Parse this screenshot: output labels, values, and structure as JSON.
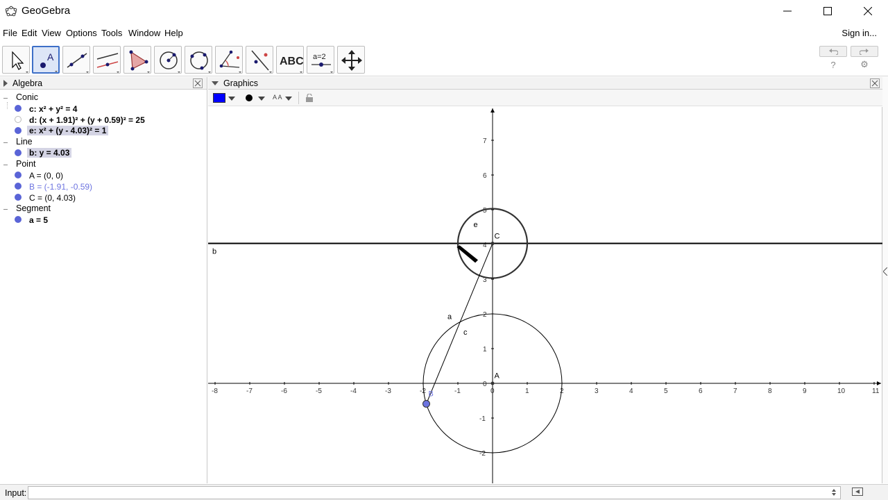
{
  "window": {
    "title": "GeoGebra"
  },
  "menu": {
    "items": [
      "File",
      "Edit",
      "View",
      "Options",
      "Tools",
      "Window",
      "Help"
    ],
    "sign_in": "Sign in..."
  },
  "toolbar": {
    "tools": [
      "move-tool",
      "point-tool",
      "line-tool",
      "perpendicular-tool",
      "polygon-tool",
      "circle-center-tool",
      "circle-three-points-tool",
      "angle-tool",
      "reflect-tool",
      "text-tool",
      "slider-tool",
      "move-graphics-tool"
    ],
    "text_tool_label": "ABC",
    "slider_tool_label": "a=2"
  },
  "algebra": {
    "title": "Algebra",
    "categories": [
      {
        "label": "Conic",
        "items": [
          "c: x² + y² = 4",
          "d: (x + 1.91)² + (y + 0.59)² = 25",
          "e: x² + (y - 4.03)² = 1"
        ]
      },
      {
        "label": "Line",
        "items": [
          "b: y = 4.03"
        ]
      },
      {
        "label": "Point",
        "items": [
          "A = (0, 0)",
          "B = (-1.91, -0.59)",
          "C = (0, 4.03)"
        ]
      },
      {
        "label": "Segment",
        "items": [
          "a = 5"
        ]
      }
    ]
  },
  "graphics": {
    "title": "Graphics",
    "color_swatch": "#0000ff",
    "text_size_label": "A A",
    "x_ticks": [
      -8,
      -7,
      -6,
      -5,
      -4,
      -3,
      -2,
      -1,
      0,
      1,
      2,
      3,
      4,
      5,
      6,
      7,
      8,
      9,
      10,
      11
    ],
    "y_ticks": [
      -2,
      -1,
      0,
      1,
      2,
      3,
      4,
      5,
      6,
      7
    ],
    "labels": {
      "line_b": "b",
      "circle_e": "e",
      "point_C": "C",
      "segment_a": "a",
      "circle_c": "c",
      "point_A": "A",
      "point_B": "B"
    },
    "objects": {
      "circle_c": {
        "cx": 0,
        "cy": 0,
        "r": 2
      },
      "circle_e": {
        "cx": 0,
        "cy": 4.03,
        "r": 1
      },
      "line_b": {
        "y": 4.03
      },
      "point_A": [
        0,
        0
      ],
      "point_B": [
        -1.91,
        -0.59
      ],
      "point_C": [
        0,
        4.03
      ]
    },
    "colors": {
      "point_B": "#6d74e0",
      "algebra_point_B_text": "#6d74e0",
      "bullet": "#5a64d7"
    }
  },
  "input": {
    "label": "Input:",
    "value": ""
  }
}
